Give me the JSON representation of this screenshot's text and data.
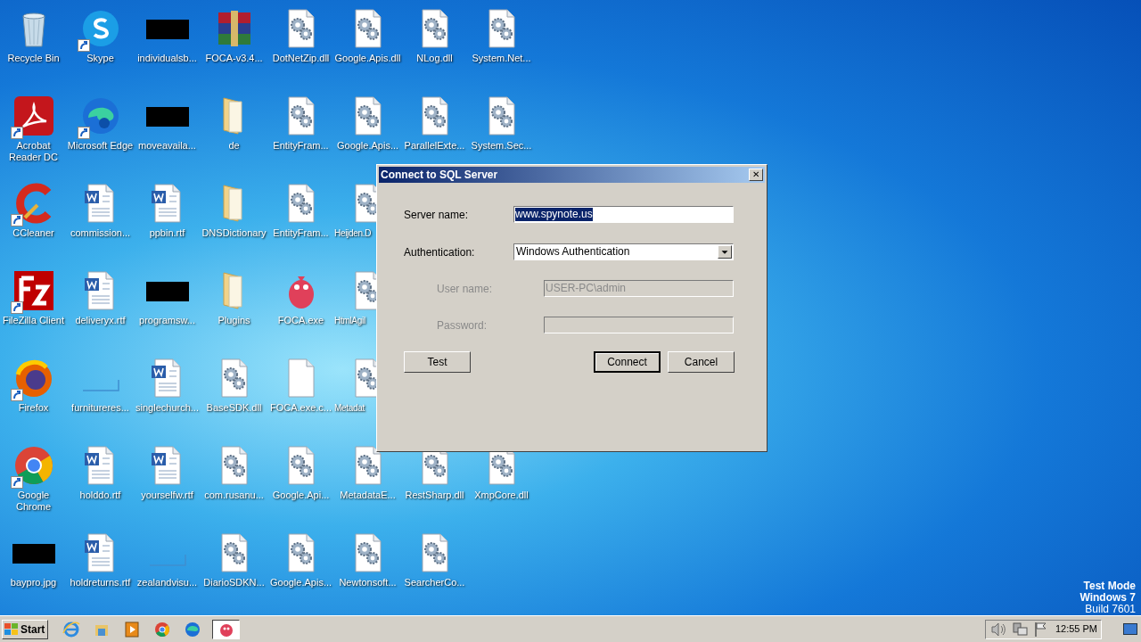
{
  "desktop": {
    "columns": [
      [
        {
          "label": "Recycle Bin",
          "kind": "trash",
          "shortcut": false
        },
        {
          "label": "Acrobat\nReader DC",
          "kind": "acrobat",
          "shortcut": true
        },
        {
          "label": "CCleaner",
          "kind": "ccleaner",
          "shortcut": true
        },
        {
          "label": "FileZilla Client",
          "kind": "filezilla",
          "shortcut": true
        },
        {
          "label": "Firefox",
          "kind": "firefox",
          "shortcut": true
        },
        {
          "label": "Google\nChrome",
          "kind": "chrome",
          "shortcut": true
        },
        {
          "label": "baypro.jpg",
          "kind": "redacted",
          "shortcut": false
        }
      ],
      [
        {
          "label": "Skype",
          "kind": "skype",
          "shortcut": true
        },
        {
          "label": "Microsoft Edge",
          "kind": "edge",
          "shortcut": true
        },
        {
          "label": "commission...",
          "kind": "word",
          "shortcut": false
        },
        {
          "label": "deliveryx.rtf",
          "kind": "word",
          "shortcut": false
        },
        {
          "label": "furnitureres...",
          "kind": "faint",
          "shortcut": false
        },
        {
          "label": "holddo.rtf",
          "kind": "word",
          "shortcut": false
        },
        {
          "label": "holdreturns.rtf",
          "kind": "word",
          "shortcut": false
        }
      ],
      [
        {
          "label": "individualsb...",
          "kind": "redacted",
          "shortcut": false
        },
        {
          "label": "moveavaila...",
          "kind": "redacted",
          "shortcut": false
        },
        {
          "label": "ppbin.rtf",
          "kind": "word",
          "shortcut": false
        },
        {
          "label": "programsw...",
          "kind": "redacted",
          "shortcut": false
        },
        {
          "label": "singlechurch...",
          "kind": "word",
          "shortcut": false
        },
        {
          "label": "yourselfw.rtf",
          "kind": "word",
          "shortcut": false
        },
        {
          "label": "zealandvisu...",
          "kind": "faint",
          "shortcut": false
        }
      ],
      [
        {
          "label": "FOCA-v3.4...",
          "kind": "archive",
          "shortcut": false
        },
        {
          "label": "de",
          "kind": "folder",
          "shortcut": false
        },
        {
          "label": "DNSDictionary",
          "kind": "folder",
          "shortcut": false
        },
        {
          "label": "Plugins",
          "kind": "folder",
          "shortcut": false
        },
        {
          "label": "BaseSDK.dll",
          "kind": "dll",
          "shortcut": false
        },
        {
          "label": "com.rusanu...",
          "kind": "dll",
          "shortcut": false
        },
        {
          "label": "DiarioSDKN...",
          "kind": "dll",
          "shortcut": false
        }
      ],
      [
        {
          "label": "DotNetZip.dll",
          "kind": "dll",
          "shortcut": false
        },
        {
          "label": "EntityFram...",
          "kind": "dll",
          "shortcut": false
        },
        {
          "label": "EntityFram...",
          "kind": "dll",
          "shortcut": false
        },
        {
          "label": "FOCA.exe",
          "kind": "foca",
          "shortcut": false
        },
        {
          "label": "FOCA.exe.c...",
          "kind": "blank",
          "shortcut": false
        },
        {
          "label": "Google.Api...",
          "kind": "dll",
          "shortcut": false
        },
        {
          "label": "Google.Apis...",
          "kind": "dll",
          "shortcut": false
        }
      ],
      [
        {
          "label": "Google.Apis.dll",
          "kind": "dll",
          "shortcut": false
        },
        {
          "label": "Google.Apis...",
          "kind": "dll",
          "shortcut": false
        },
        {
          "label": "Heijden.D",
          "kind": "dll",
          "shortcut": false,
          "clipped": true
        },
        {
          "label": "HtmlAgil",
          "kind": "dll",
          "shortcut": false,
          "clipped": true
        },
        {
          "label": "Metadat",
          "kind": "dll",
          "shortcut": false,
          "clipped": true
        },
        {
          "label": "MetadataE...",
          "kind": "dll",
          "shortcut": false
        },
        {
          "label": "Newtonsoft...",
          "kind": "dll",
          "shortcut": false
        }
      ],
      [
        {
          "label": "NLog.dll",
          "kind": "dll",
          "shortcut": false
        },
        {
          "label": "ParallelExte...",
          "kind": "dll",
          "shortcut": false
        },
        {
          "kind": "covered"
        },
        {
          "kind": "covered"
        },
        {
          "kind": "covered"
        },
        {
          "label": "RestSharp.dll",
          "kind": "dll",
          "shortcut": false
        },
        {
          "label": "SearcherCo...",
          "kind": "dll",
          "shortcut": false
        }
      ],
      [
        {
          "label": "System.Net...",
          "kind": "dll",
          "shortcut": false
        },
        {
          "label": "System.Sec...",
          "kind": "dll",
          "shortcut": false
        },
        {
          "kind": "covered"
        },
        {
          "kind": "covered"
        },
        {
          "kind": "covered"
        },
        {
          "label": "XmpCore.dll",
          "kind": "dll",
          "shortcut": false
        }
      ]
    ]
  },
  "dialog": {
    "title": "Connect to SQL Server",
    "close": "✕",
    "server_name": {
      "label": "Server name:",
      "value": "www.spynote.us",
      "selected": true
    },
    "authentication": {
      "label": "Authentication:",
      "value": "Windows Authentication"
    },
    "user_name": {
      "label": "User  name:",
      "value": "USER-PC\\admin",
      "disabled": true
    },
    "password": {
      "label": "Password:",
      "disabled": true
    },
    "buttons": [
      {
        "label": "Test",
        "default": false
      },
      {
        "label": "Connect",
        "default": true
      },
      {
        "label": "Cancel",
        "default": false
      }
    ]
  },
  "system_text": [
    {
      "text": "Test Mode",
      "bold": true
    },
    {
      "text": "Windows 7",
      "bold": true
    },
    {
      "text": "Build 7601",
      "bold": false
    }
  ],
  "taskbar": {
    "start": "Start",
    "quick_launch": [
      {
        "kind": "ie"
      },
      {
        "kind": "explorer"
      },
      {
        "kind": "media"
      },
      {
        "kind": "chrome"
      },
      {
        "kind": "edge"
      }
    ],
    "tasks": [
      {
        "kind": "foca",
        "active": true
      }
    ],
    "tray": [
      {
        "kind": "speaker"
      },
      {
        "kind": "network"
      },
      {
        "kind": "flag"
      }
    ],
    "clock": "12:55 PM"
  }
}
